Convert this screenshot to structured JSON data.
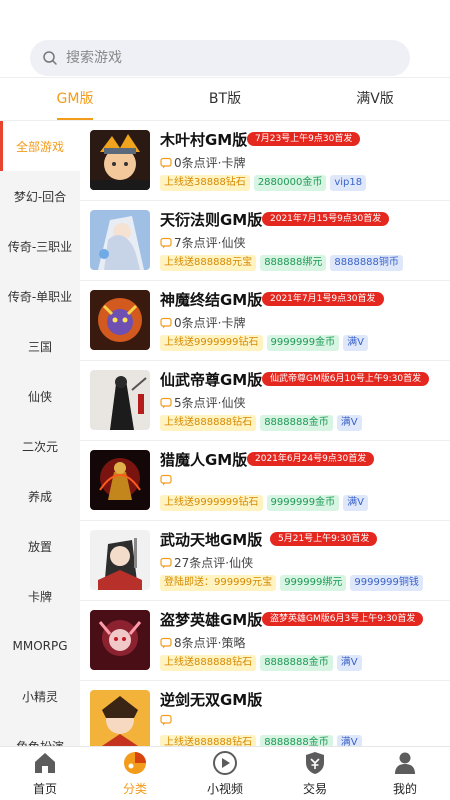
{
  "search": {
    "placeholder": "搜索游戏"
  },
  "tabs": [
    {
      "label": "GM版",
      "active": true
    },
    {
      "label": "BT版",
      "active": false
    },
    {
      "label": "满V版",
      "active": false
    }
  ],
  "sidebar": [
    {
      "label": "全部游戏",
      "active": true
    },
    {
      "label": "梦幻-回合"
    },
    {
      "label": "传奇-三职业"
    },
    {
      "label": "传奇-单职业"
    },
    {
      "label": "三国"
    },
    {
      "label": "仙侠"
    },
    {
      "label": "二次元"
    },
    {
      "label": "养成"
    },
    {
      "label": "放置"
    },
    {
      "label": "卡牌"
    },
    {
      "label": "MMORPG"
    },
    {
      "label": "小精灵"
    },
    {
      "label": "角色扮演"
    }
  ],
  "games": [
    {
      "title": "木叶村GM版",
      "date": "7月23号上午9点30首发",
      "meta": "0条点评·卡牌",
      "tags": [
        {
          "text": "上线送38888钻石",
          "color": "y"
        },
        {
          "text": "2880000金币",
          "color": "g"
        },
        {
          "text": "vip18",
          "color": "b"
        }
      ]
    },
    {
      "title": "天衍法则GM版",
      "date": "2021年7月15号9点30首发",
      "meta": "7条点评·仙侠",
      "tags": [
        {
          "text": "上线送888888元宝",
          "color": "y"
        },
        {
          "text": "888888绑元",
          "color": "g"
        },
        {
          "text": "8888888铜币",
          "color": "b"
        }
      ]
    },
    {
      "title": "神魔终结GM版",
      "date": "2021年7月1号9点30首发",
      "meta": "0条点评·卡牌",
      "tags": [
        {
          "text": "上线送9999999钻石",
          "color": "y"
        },
        {
          "text": "9999999金币",
          "color": "g"
        },
        {
          "text": "满V",
          "color": "b"
        }
      ]
    },
    {
      "title": "仙武帝尊GM版",
      "date": "仙武帝尊GM版6月10号上午9:30首发",
      "meta": "5条点评·仙侠",
      "tags": [
        {
          "text": "上线送888888钻石",
          "color": "y"
        },
        {
          "text": "8888888金币",
          "color": "g"
        },
        {
          "text": "满V",
          "color": "b"
        }
      ]
    },
    {
      "title": "猎魔人GM版",
      "date": "2021年6月24号9点30首发",
      "meta": "",
      "tags": [
        {
          "text": "上线送9999999钻石",
          "color": "y"
        },
        {
          "text": "9999999金币",
          "color": "g"
        },
        {
          "text": "满V",
          "color": "b"
        }
      ]
    },
    {
      "title": "武动天地GM版",
      "date": "5月21号上午9:30首发",
      "meta": "27条点评·仙侠",
      "tags": [
        {
          "text": "登陆即送：999999元宝",
          "color": "y"
        },
        {
          "text": "999999绑元",
          "color": "g"
        },
        {
          "text": "9999999铜钱",
          "color": "b"
        }
      ]
    },
    {
      "title": "盗梦英雄GM版",
      "date": "盗梦英雄GM版6月3号上午9:30首发",
      "meta": "8条点评·策略",
      "tags": [
        {
          "text": "上线送888888钻石",
          "color": "y"
        },
        {
          "text": "8888888金币",
          "color": "g"
        },
        {
          "text": "满V",
          "color": "b"
        }
      ]
    },
    {
      "title": "逆剑无双GM版",
      "date": "",
      "meta": "",
      "tags": [
        {
          "text": "上线送888888钻石",
          "color": "y"
        },
        {
          "text": "8888888金币",
          "color": "g"
        },
        {
          "text": "满V",
          "color": "b"
        }
      ]
    }
  ],
  "bottom_nav": [
    {
      "label": "首页",
      "icon": "home-icon",
      "active": false
    },
    {
      "label": "分类",
      "icon": "category-icon",
      "active": true
    },
    {
      "label": "小视频",
      "icon": "video-icon",
      "active": false
    },
    {
      "label": "交易",
      "icon": "trade-icon",
      "active": false
    },
    {
      "label": "我的",
      "icon": "user-icon",
      "active": false
    }
  ],
  "colors": {
    "accent": "#f39b1a",
    "date_badge": "#e5281f",
    "sidebar_bg": "#f4f4f4"
  }
}
